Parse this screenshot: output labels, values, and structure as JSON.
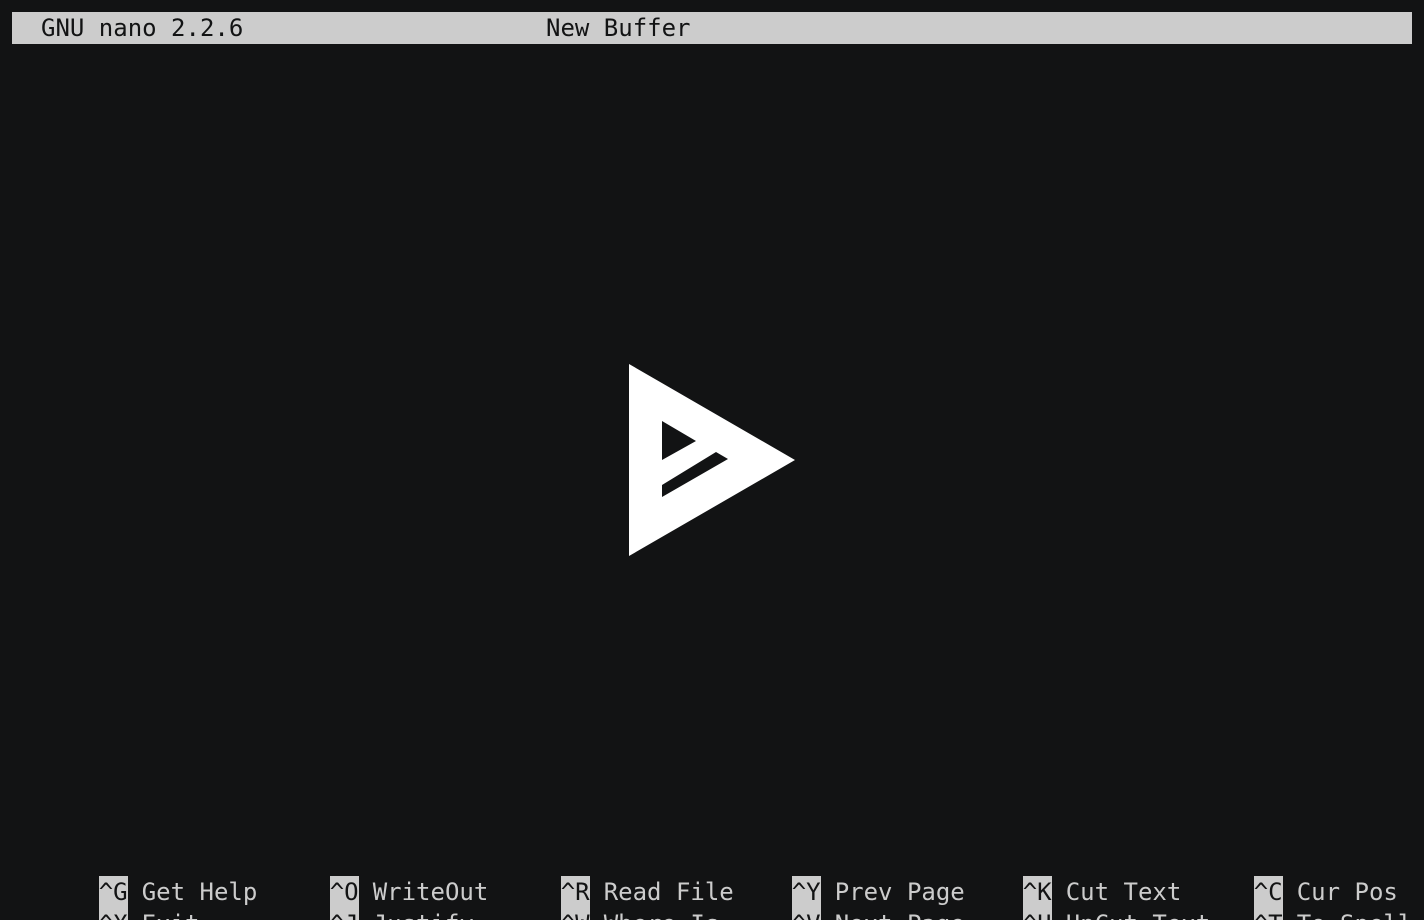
{
  "titlebar": {
    "version": "GNU nano 2.2.6",
    "buffer": "New Buffer"
  },
  "center_logo": {
    "icon": "play-logo-icon",
    "color": "#ffffff"
  },
  "colors": {
    "background": "#121314",
    "bar": "#cccccc",
    "text": "#cccccc"
  },
  "shortcuts": {
    "row1": [
      {
        "key": "^G",
        "label": "Get Help"
      },
      {
        "key": "^O",
        "label": "WriteOut"
      },
      {
        "key": "^R",
        "label": "Read File"
      },
      {
        "key": "^Y",
        "label": "Prev Page"
      },
      {
        "key": "^K",
        "label": "Cut Text"
      },
      {
        "key": "^C",
        "label": "Cur Pos"
      }
    ],
    "row2": [
      {
        "key": "^X",
        "label": "Exit"
      },
      {
        "key": "^J",
        "label": "Justify"
      },
      {
        "key": "^W",
        "label": "Where Is"
      },
      {
        "key": "^V",
        "label": "Next Page"
      },
      {
        "key": "^U",
        "label": "UnCut Text"
      },
      {
        "key": "^T",
        "label": "To Spell"
      }
    ]
  }
}
